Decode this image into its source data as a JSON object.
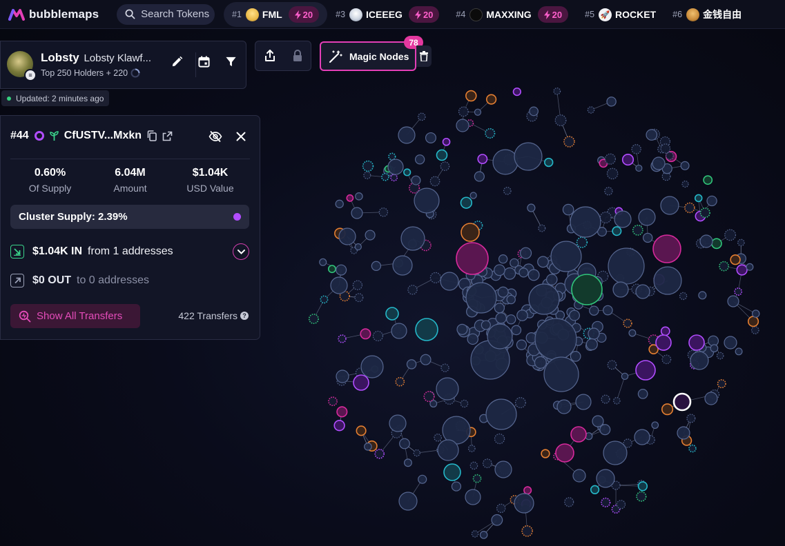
{
  "app": {
    "logo_text": "bubblemaps"
  },
  "search": {
    "label": "Search Tokens"
  },
  "trending": [
    {
      "rank": "#1",
      "name": "FML",
      "boost": "20",
      "avatar_color": "#e9b949"
    },
    {
      "rank": "#3",
      "name": "ICEEEG",
      "boost": "20",
      "avatar_color": "#cfd6e2"
    },
    {
      "rank": "#4",
      "name": "MAXXING",
      "boost": "20",
      "avatar_color": "#0b0b0b"
    },
    {
      "rank": "#5",
      "name": "ROCKET",
      "boost": "",
      "avatar_color": "#f1f1f4"
    },
    {
      "rank": "#6",
      "name": "金钱自由",
      "boost": "",
      "avatar_color": "#c88a3a"
    }
  ],
  "token": {
    "name": "Lobsty",
    "full_name": "Lobsty Klawf...",
    "subtitle": "Top 250 Holders + 220",
    "updated": "Updated: 2 minutes ago"
  },
  "magic_nodes": {
    "label": "Magic Nodes",
    "count": "78"
  },
  "holder": {
    "rank": "#44",
    "address": "CfUSTV...Mxkn",
    "stats": [
      {
        "value": "0.60%",
        "label": "Of Supply"
      },
      {
        "value": "6.04M",
        "label": "Amount"
      },
      {
        "value": "$1.04K",
        "label": "USD Value"
      }
    ],
    "cluster_supply": "Cluster Supply: 2.39%",
    "in_amount": "$1.04K IN",
    "in_desc": "from 1 addresses",
    "out_amount": "$0 OUT",
    "out_desc": "to 0 addresses",
    "show_transfers": "Show All Transfers",
    "transfers_count": "422 Transfers"
  },
  "colors": {
    "accent_pink": "#e43fb7",
    "cluster_purple": "#b24dff",
    "node_fill": "#1d2844",
    "node_stroke": "#56668f",
    "orange": "#e57f32",
    "cyan": "#25b8c9",
    "green": "#30c37a",
    "magenta": "#d72a9c"
  }
}
